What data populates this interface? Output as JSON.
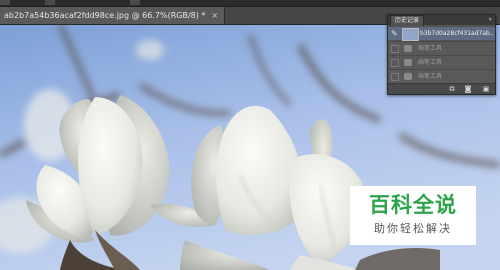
{
  "document": {
    "tab_title": "ab2b7a54b36acaf2fdd98ce.jpg @ 66.7%(RGB/8) *",
    "tab_close": "×"
  },
  "history_panel": {
    "tab_label": "历史记录",
    "expand_icon": "»",
    "snapshot_label": "b3b7d0a28cf431ad7ab...",
    "steps": [
      {
        "label": "画笔工具"
      },
      {
        "label": "画笔工具"
      },
      {
        "label": "画笔工具"
      }
    ],
    "footer_icons": [
      "new-document-from-state-icon",
      "camera-icon",
      "trash-icon"
    ]
  },
  "watermark": {
    "title": "百科全说",
    "subtitle": "助你轻松解决"
  },
  "colors": {
    "sky_light": "#b3c9ef",
    "sky_dark": "#7d9fd6",
    "watermark_green": "#2da44a",
    "panel_bg": "#535353"
  }
}
